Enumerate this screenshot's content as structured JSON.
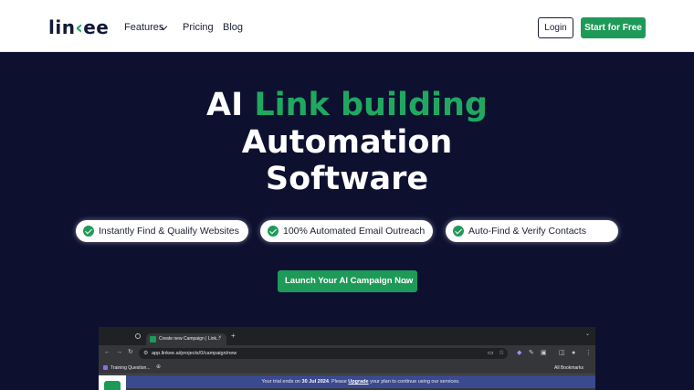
{
  "navbar": {
    "logo_prefix": "lin",
    "logo_mark": "‹",
    "logo_suffix": "ee",
    "features_label": "Features",
    "pricing_label": "Pricing",
    "blog_label": "Blog",
    "login_label": "Login",
    "start_label": "Start for Free"
  },
  "hero": {
    "title_line1_white": "AI ",
    "title_line1_green": "Link building",
    "title_line2": "Automation",
    "title_line3": "Software",
    "features": [
      {
        "label": "Instantly Find & Qualify Websites",
        "icon": "check-circle-icon"
      },
      {
        "label": "100% Automated Email Outreach",
        "icon": "check-circle-icon"
      },
      {
        "label": "Auto-Find & Verify Contacts",
        "icon": "check-circle-icon"
      }
    ],
    "cta_label": "Launch Your AI Campaign Now",
    "cta_arrow": "→"
  },
  "browser": {
    "tab_title": "Create new Campaign | Link...",
    "tab_close": "×",
    "new_tab": "+",
    "url": "app.linkee.ai/projects/0/campaign/new",
    "bookmark_label": "Training Question...",
    "all_bookmarks": "All Bookmarks",
    "trial_prefix": "Your trial ends on ",
    "trial_date": "30 Jul 2024",
    "trial_middle": ". Please ",
    "trial_upgrade": "Upgrade",
    "trial_suffix": " your plan to continue using our services."
  },
  "colors": {
    "brand_green": "#1e9a58",
    "hero_bg": "#0e1030",
    "navy_text": "#111a3a"
  }
}
